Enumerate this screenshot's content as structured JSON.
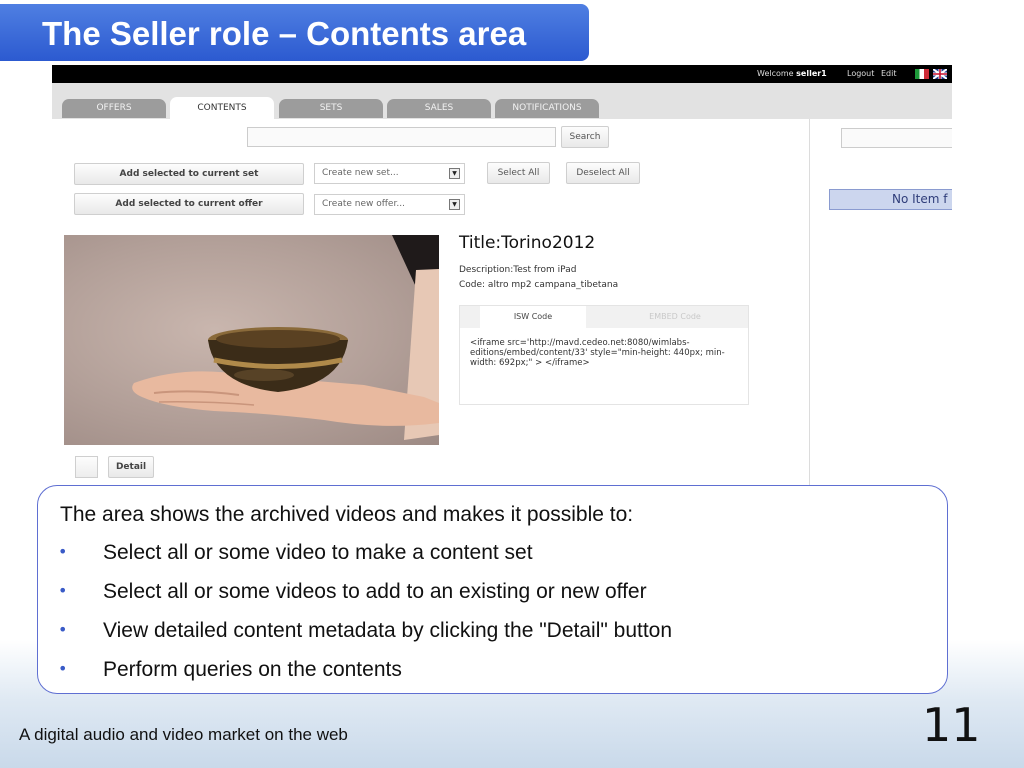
{
  "slide": {
    "title": "The Seller role – Contents area",
    "footer": "A digital audio and video market on the web",
    "page_number": "11",
    "accent_color": "#3a67d9",
    "intro": "The  area shows the archived videos and makes it possible to:",
    "bullets": [
      "Select all or some video to make a content set",
      "Select all or some videos to add to an existing or new offer",
      "View detailed content metadata by clicking the \"Detail\" button",
      "Perform queries on the contents"
    ]
  },
  "app": {
    "welcome_prefix": "Welcome ",
    "user": "seller1",
    "logout": "Logout",
    "edit": "Edit",
    "flags": [
      "italy-flag",
      "uk-flag"
    ],
    "tabs": [
      "OFFERS",
      "CONTENTS",
      "SETS",
      "SALES",
      "NOTIFICATIONS"
    ],
    "active_tab": "CONTENTS",
    "search_value": "",
    "search_button": "Search",
    "add_to_set": "Add selected to current set",
    "add_to_offer": "Add selected to current offer",
    "set_select": "Create new set...",
    "offer_select": "Create new offer...",
    "select_all": "Select All",
    "deselect_all": "Deselect All",
    "no_item": "No Item f",
    "item": {
      "title": "Title:Torino2012",
      "description": "Description:Test from iPad",
      "code": "Code: altro mp2 campana_tibetana",
      "code_tabs": [
        "ISW Code",
        "EMBED Code"
      ],
      "embed_code": "<iframe src='http://mavd.cedeo.net:8080/wimlabs-editions/embed/content/33' style=\"min-height: 440px; min-width: 692px;\" > </iframe>"
    },
    "detail_button": "Detail"
  }
}
